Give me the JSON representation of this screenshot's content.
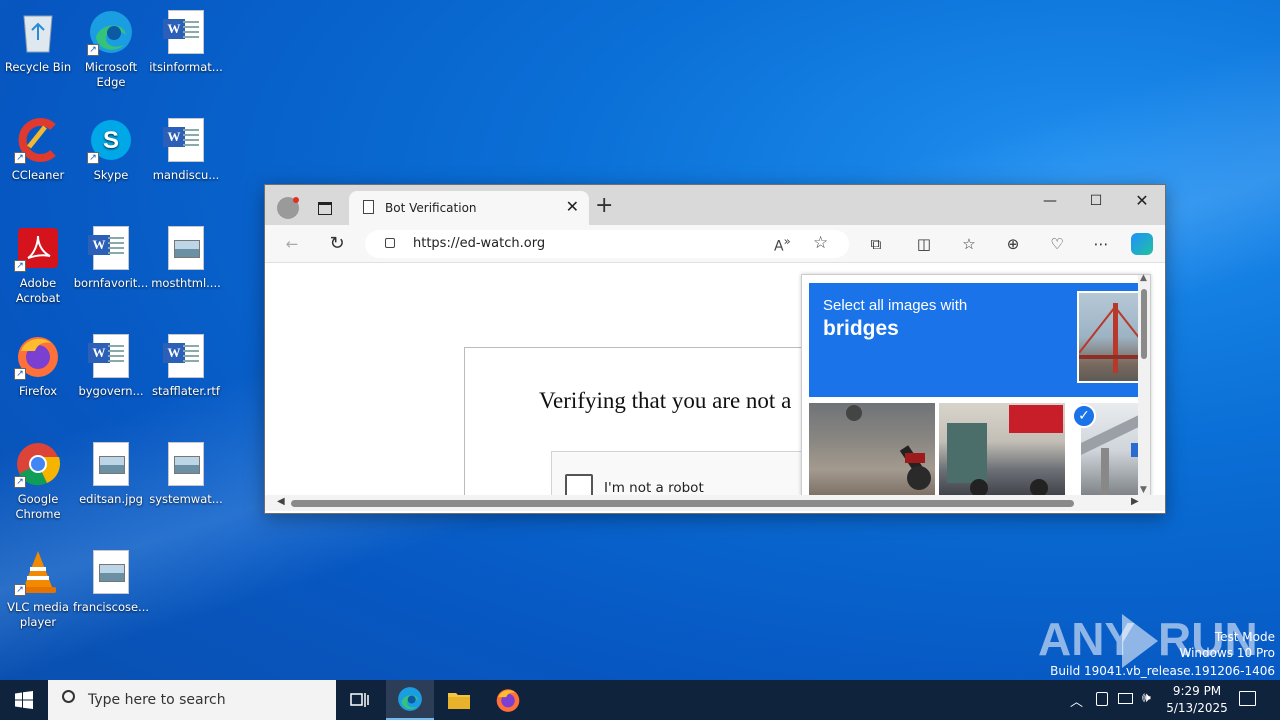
{
  "desktop": {
    "icons": [
      {
        "label": "Recycle Bin"
      },
      {
        "label": "Microsoft Edge"
      },
      {
        "label": "itsinformat..."
      },
      {
        "label": "CCleaner"
      },
      {
        "label": "Skype"
      },
      {
        "label": "mandiscu..."
      },
      {
        "label": "Adobe Acrobat"
      },
      {
        "label": "bornfavorit..."
      },
      {
        "label": "mosthtml...."
      },
      {
        "label": "Firefox"
      },
      {
        "label": "bygovern..."
      },
      {
        "label": "stafflater.rtf"
      },
      {
        "label": "Google Chrome"
      },
      {
        "label": "editsan.jpg"
      },
      {
        "label": "systemwat..."
      },
      {
        "label": "VLC media player"
      },
      {
        "label": "franciscose..."
      }
    ]
  },
  "browser": {
    "tab_title": "Bot Verification",
    "url": "https://ed-watch.org",
    "page_heading": "Verifying that you are not a",
    "checkbox_label": "I'm not a robot",
    "captcha": {
      "instruction": "Select all images with",
      "target": "bridges"
    }
  },
  "watermark": {
    "brand_left": "ANY",
    "brand_right": "RUN",
    "line1": "Test Mode",
    "line2": "Windows 10 Pro",
    "line3": "Build 19041.vb_release.191206-1406"
  },
  "taskbar": {
    "search_placeholder": "Type here to search",
    "time": "9:29 PM",
    "date": "5/13/2025"
  },
  "colors": {
    "accent": "#1a73e8",
    "taskbar": "#10233d"
  }
}
